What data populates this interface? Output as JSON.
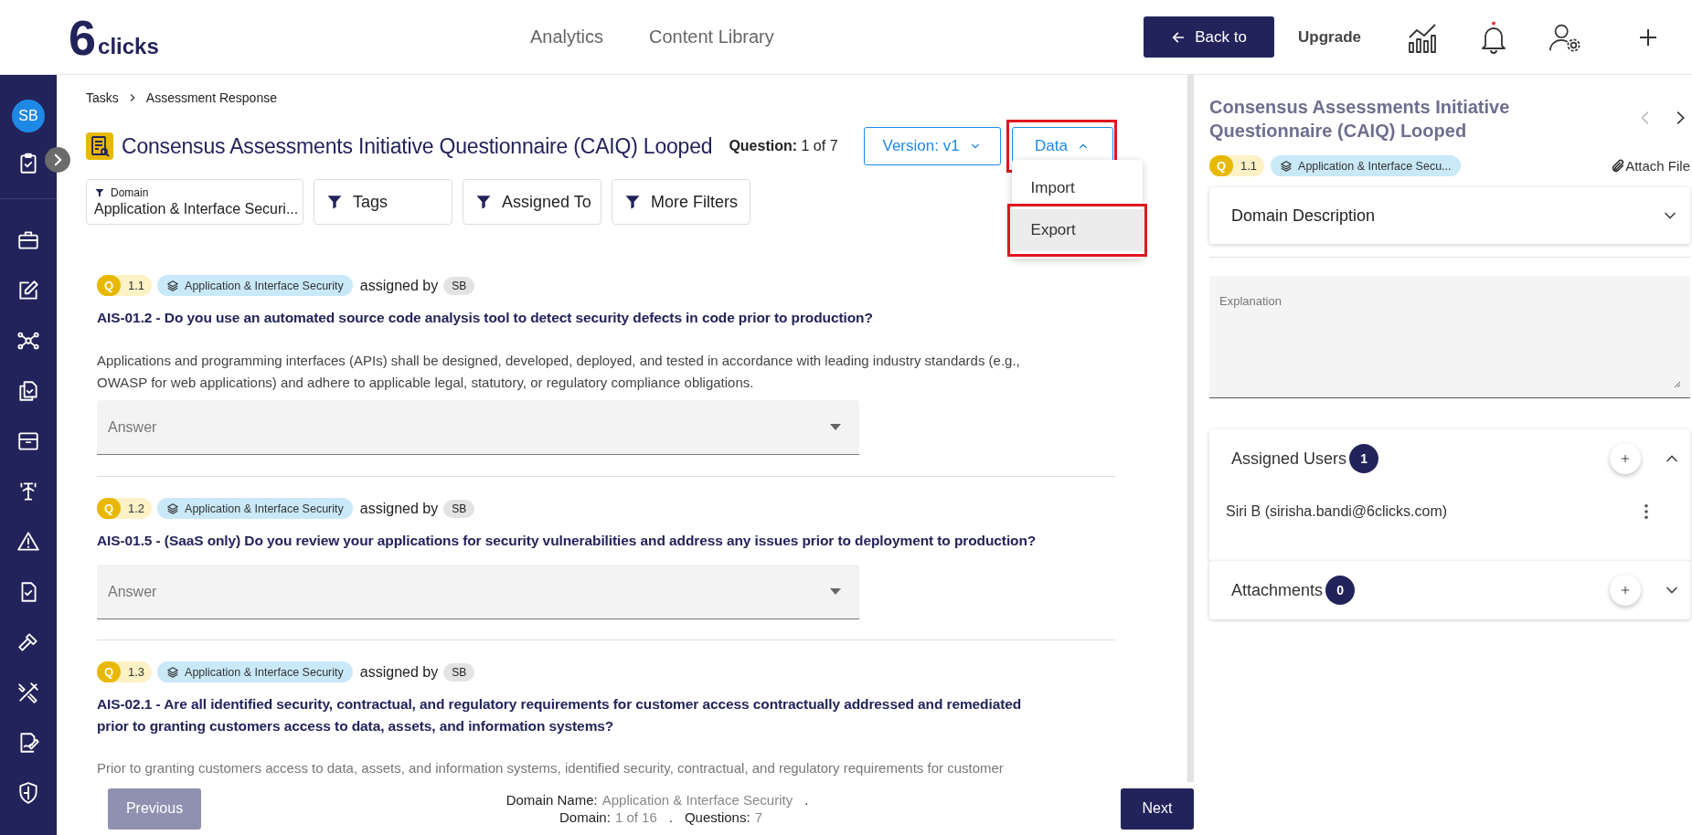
{
  "header": {
    "logo_digit": "6",
    "logo_text": "clicks",
    "nav": [
      {
        "label": "Analytics"
      },
      {
        "label": "Content Library"
      }
    ],
    "back_button": "Back to",
    "upgrade": "Upgrade",
    "notification_dot": true
  },
  "sidebar": {
    "avatar": "SB"
  },
  "breadcrumb": [
    "Tasks",
    "Assessment Response"
  ],
  "title": "Consensus Assessments Initiative Questionnaire (CAIQ) Looped",
  "question_counter": {
    "label": "Question:",
    "value": "1 of 7"
  },
  "version_button": "Version: v1",
  "data_button": {
    "label": "Data",
    "expanded": true,
    "highlighted": true
  },
  "data_menu": [
    {
      "label": "Import",
      "hovered": false,
      "highlighted": false
    },
    {
      "label": "Export",
      "hovered": true,
      "highlighted": true
    }
  ],
  "filters": [
    {
      "kind": "labeled",
      "caption": "Domain",
      "value": "Application & Interface Securi..."
    },
    {
      "kind": "plain",
      "label": "Tags"
    },
    {
      "kind": "plain",
      "label": "Assigned To"
    },
    {
      "kind": "plain",
      "label": "More Filters"
    }
  ],
  "questions": [
    {
      "badge": "Q",
      "number": "1.1",
      "domain": "Application & Interface Security",
      "assigned_by": "assigned by",
      "assignee": "SB",
      "title": "AIS-01.2 - Do you use an automated source code analysis tool to detect security defects in code prior to production?",
      "description": "Applications and programming interfaces (APIs) shall be designed, developed, deployed, and tested in accordance with leading industry standards (e.g., OWASP for web applications) and adhere to applicable legal, statutory, or regulatory compliance obligations.",
      "answer_placeholder": "Answer"
    },
    {
      "badge": "Q",
      "number": "1.2",
      "domain": "Application & Interface Security",
      "assigned_by": "assigned by",
      "assignee": "SB",
      "title": "AIS-01.5 - (SaaS only) Do you review your applications for security vulnerabilities and address any issues prior to deployment to production?",
      "answer_placeholder": "Answer"
    },
    {
      "badge": "Q",
      "number": "1.3",
      "domain": "Application & Interface Security",
      "assigned_by": "assigned by",
      "assignee": "SB",
      "title": "AIS-02.1 - Are all identified security, contractual, and regulatory requirements for customer access contractually addressed and remediated prior to granting customers access to data, assets, and information systems?",
      "description": "Prior to granting customers access to data, assets, and information systems, identified security, contractual, and regulatory requirements for customer"
    }
  ],
  "footer": {
    "previous": {
      "label": "Previous",
      "disabled": true
    },
    "domain_name_label": "Domain Name:",
    "domain_name": "Application & Interface Security",
    "separator_1": ".",
    "domain_label": "Domain:",
    "domain_value": "1 of 16",
    "separator_2": ".",
    "questions_label": "Questions:",
    "questions_value": "7",
    "next": {
      "label": "Next",
      "disabled": false
    }
  },
  "detail": {
    "title": "Consensus Assessments Initiative Questionnaire (CAIQ) Looped",
    "prev_disabled": true,
    "next_disabled": false,
    "badge": "Q",
    "number": "1.1",
    "domain": "Application & Interface Secu...",
    "attach": "Attach File",
    "domain_description": {
      "title": "Domain Description",
      "expanded": false
    },
    "explanation_placeholder": "Explanation",
    "assigned_users": {
      "title": "Assigned Users",
      "count": "1",
      "expanded": true,
      "users": [
        "Siri B (sirisha.bandi@6clicks.com)"
      ]
    },
    "attachments": {
      "title": "Attachments",
      "count": "0",
      "expanded": false
    }
  }
}
